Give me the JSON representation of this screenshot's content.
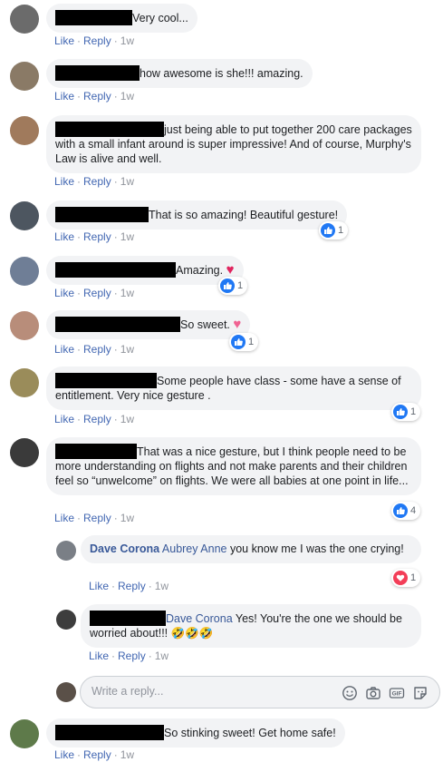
{
  "actions": {
    "like": "Like",
    "reply": "Reply",
    "time": "1w"
  },
  "comments": [
    {
      "text": "Very cool...",
      "avatar_color": "#6b6b6b"
    },
    {
      "text": "how awesome is she!!! amazing.",
      "avatar_color": "#8a7a66"
    },
    {
      "text": "just being able to put together 200 care packages with a small infant around is super impressive! And of course, Murphy's Law is alive and well.",
      "avatar_color": "#a07a5c"
    },
    {
      "text": "That is so amazing! Beautiful gesture!",
      "avatar_color": "#4d5660",
      "reaction_count": "1"
    },
    {
      "text": "Amazing. ",
      "avatar_color": "#6f7e96",
      "reaction_count": "1"
    },
    {
      "text": "So sweet. ",
      "avatar_color": "#b88d7a",
      "reaction_count": "1"
    },
    {
      "text": "Some people have class - some have a sense of entitlement. Very nice gesture .",
      "avatar_color": "#9a8c5a",
      "reaction_count": "1"
    },
    {
      "text": "That was a nice gesture, but I think people need to be more understanding on flights and not make parents and their children feel so “unwelcome” on flights. We were all babies at one point in life...",
      "avatar_color": "#3a3a3a",
      "reaction_count": "4"
    },
    {
      "text": "So stinking sweet! Get home safe!",
      "avatar_color": "#5e7a4a"
    }
  ],
  "replies": [
    {
      "author": "Dave Corona",
      "mention": "Aubrey Anne",
      "text": " you know me I was the one crying!",
      "avatar_color": "#7a7f86",
      "reaction_count": "1"
    },
    {
      "mention": "Dave Corona",
      "text": " Yes! You're the one we should be worried about!!! 🤣🤣🤣",
      "avatar_color": "#3d3d3d"
    }
  ],
  "reply_box": {
    "placeholder": "Write a reply...",
    "avatar_color": "#5a5048"
  },
  "colors": {
    "like_blue": "#2078f4",
    "love_red": "#f33e58",
    "link_blue": "#4267b2",
    "bubble_gray": "#f2f3f5"
  }
}
